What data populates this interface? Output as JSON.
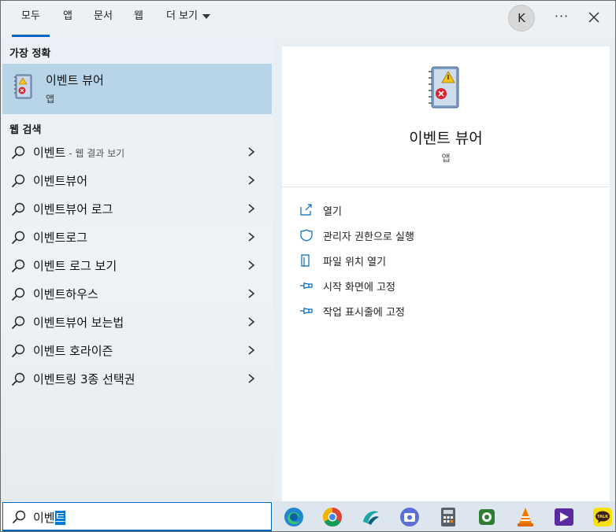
{
  "tabs": [
    {
      "label": "모두",
      "active": true
    },
    {
      "label": "앱"
    },
    {
      "label": "문서"
    },
    {
      "label": "웹"
    },
    {
      "label": "더 보기"
    }
  ],
  "user": {
    "initial": "K"
  },
  "more_label": "···",
  "best_match": {
    "heading": "가장 정확",
    "name": "이벤트 뷰어",
    "type": "앱",
    "icon": "event-viewer-icon"
  },
  "web_search": {
    "heading": "웹 검색",
    "items": [
      {
        "text": "이벤트",
        "suffix": " - 웹 결과 보기"
      },
      {
        "text": "이벤트뷰어"
      },
      {
        "text": "이벤트뷰어 로그"
      },
      {
        "text": "이벤트로그"
      },
      {
        "text": "이벤트 로그 보기"
      },
      {
        "text": "이벤트하우스"
      },
      {
        "text": "이벤트뷰어 보는법"
      },
      {
        "text": "이벤트 호라이즌"
      },
      {
        "text": "이벤트링 3종 선택권"
      }
    ]
  },
  "detail": {
    "title": "이벤트 뷰어",
    "type": "앱",
    "actions": [
      {
        "label": "열기",
        "icon": "open-icon"
      },
      {
        "label": "관리자 권한으로 실행",
        "icon": "shield-icon"
      },
      {
        "label": "파일 위치 열기",
        "icon": "file-location-icon"
      },
      {
        "label": "시작 화면에 고정",
        "icon": "pin-icon"
      },
      {
        "label": "작업 표시줄에 고정",
        "icon": "pin-icon"
      }
    ]
  },
  "search": {
    "value_plain": "이벤",
    "value_selected": "트"
  },
  "taskbar": [
    "edge-icon",
    "chrome-icon",
    "app-icon",
    "camera-icon",
    "calculator-icon",
    "app-icon",
    "vlc-icon",
    "video-editor-icon",
    "kakaotalk-icon"
  ],
  "colors": {
    "accent": "#0067c0",
    "selected": "#b8d4e8",
    "kakao": "#fae100"
  }
}
